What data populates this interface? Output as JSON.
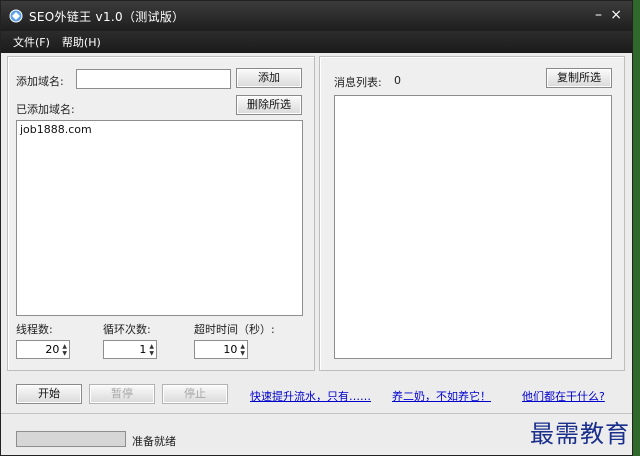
{
  "window": {
    "title": "SEO外链王 v1.0（测试版）",
    "minimize": "–",
    "close": "×"
  },
  "menu": {
    "file": "文件(F)",
    "help": "帮助(H)"
  },
  "left": {
    "add_domain_label": "添加域名:",
    "add_domain_value": "",
    "add_button": "添加",
    "added_label": "已添加域名:",
    "delete_button": "删除所选",
    "domains": [
      "job1888.com"
    ],
    "threads_label": "线程数:",
    "threads_value": "20",
    "loops_label": "循环次数:",
    "loops_value": "1",
    "timeout_label": "超时时间（秒）:",
    "timeout_value": "10"
  },
  "right": {
    "messages_label": "消息列表:",
    "messages_count": "0",
    "copy_button": "复制所选"
  },
  "controls": {
    "start": "开始",
    "pause": "暂停",
    "stop": "停止"
  },
  "links": {
    "link1": "快速提升流水，只有……",
    "link2": "养二奶，不如养它！",
    "link3": "他们都在干什么?"
  },
  "status": {
    "text": "准备就绪",
    "progress": 0
  },
  "watermark": "最需教育",
  "colors": {
    "titlebar": "#1e1e1e",
    "link": "#0000cc",
    "watermark": "#1a2f8c"
  }
}
